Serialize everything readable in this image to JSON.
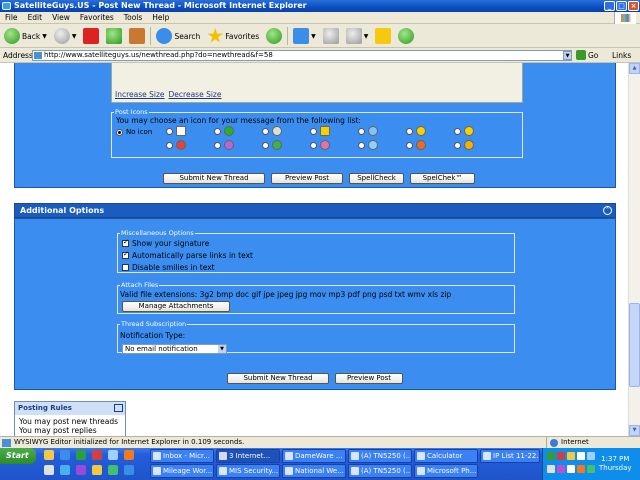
{
  "window": {
    "title": "SatelliteGuys.US - Post New Thread - Microsoft Internet Explorer"
  },
  "menu": [
    "File",
    "Edit",
    "View",
    "Favorites",
    "Tools",
    "Help"
  ],
  "toolbar": {
    "back": "Back",
    "search": "Search",
    "favorites": "Favorites"
  },
  "address": {
    "label": "Address",
    "url": "http://www.satelliteguys.us/newthread.php?do=newthread&f=58",
    "go": "Go",
    "links": "Links"
  },
  "editor": {
    "increase": "Increase Size",
    "decrease": "Decrease Size"
  },
  "post_icons": {
    "legend": "Post Icons",
    "instruction": "You may choose an icon for your message from the following list:",
    "no_icon": "No icon"
  },
  "buttons1": [
    "Submit New Thread",
    "Preview Post",
    "SpellCheck",
    "SpelChek™"
  ],
  "additional": {
    "title": "Additional Options"
  },
  "misc": {
    "legend": "Miscellaneous Options",
    "options": [
      {
        "label": "Show your signature",
        "checked": true
      },
      {
        "label": "Automatically parse links in text",
        "checked": true
      },
      {
        "label": "Disable smilies in text",
        "checked": false
      }
    ]
  },
  "attach": {
    "legend": "Attach Files",
    "extensions": "Valid file extensions: 3g2 bmp doc gif jpe jpeg jpg mov mp3 pdf png psd txt wmv xls zip",
    "button": "Manage Attachments"
  },
  "subscription": {
    "legend": "Thread Subscription",
    "label": "Notification Type:",
    "selected": "No email notification"
  },
  "buttons2": [
    "Submit New Thread",
    "Preview Post"
  ],
  "rules": {
    "title": "Posting Rules",
    "line1": "You may post new threads",
    "line2": "You may post replies"
  },
  "status": {
    "text": "WYSIWYG Editor initialized for Internet Explorer in 0.109 seconds.",
    "zone": "Internet"
  },
  "taskbar": {
    "start": "Start",
    "tasks_top": [
      "Inbox - Micr...",
      "3 Internet...",
      "DameWare ...",
      "(A) TN5250 (...",
      "Calculator",
      "IP List 11-22..."
    ],
    "tasks_bottom": [
      "Mileage Wor...",
      "MIS Security...",
      "National We...",
      "(A) TN5250 (...",
      "Microsoft Ph..."
    ],
    "time": "1:37 PM",
    "day": "Thursday"
  },
  "colors": {
    "panel": "#3b8ef0",
    "header": "#1b5cc0",
    "taskbar": "#245edb"
  }
}
